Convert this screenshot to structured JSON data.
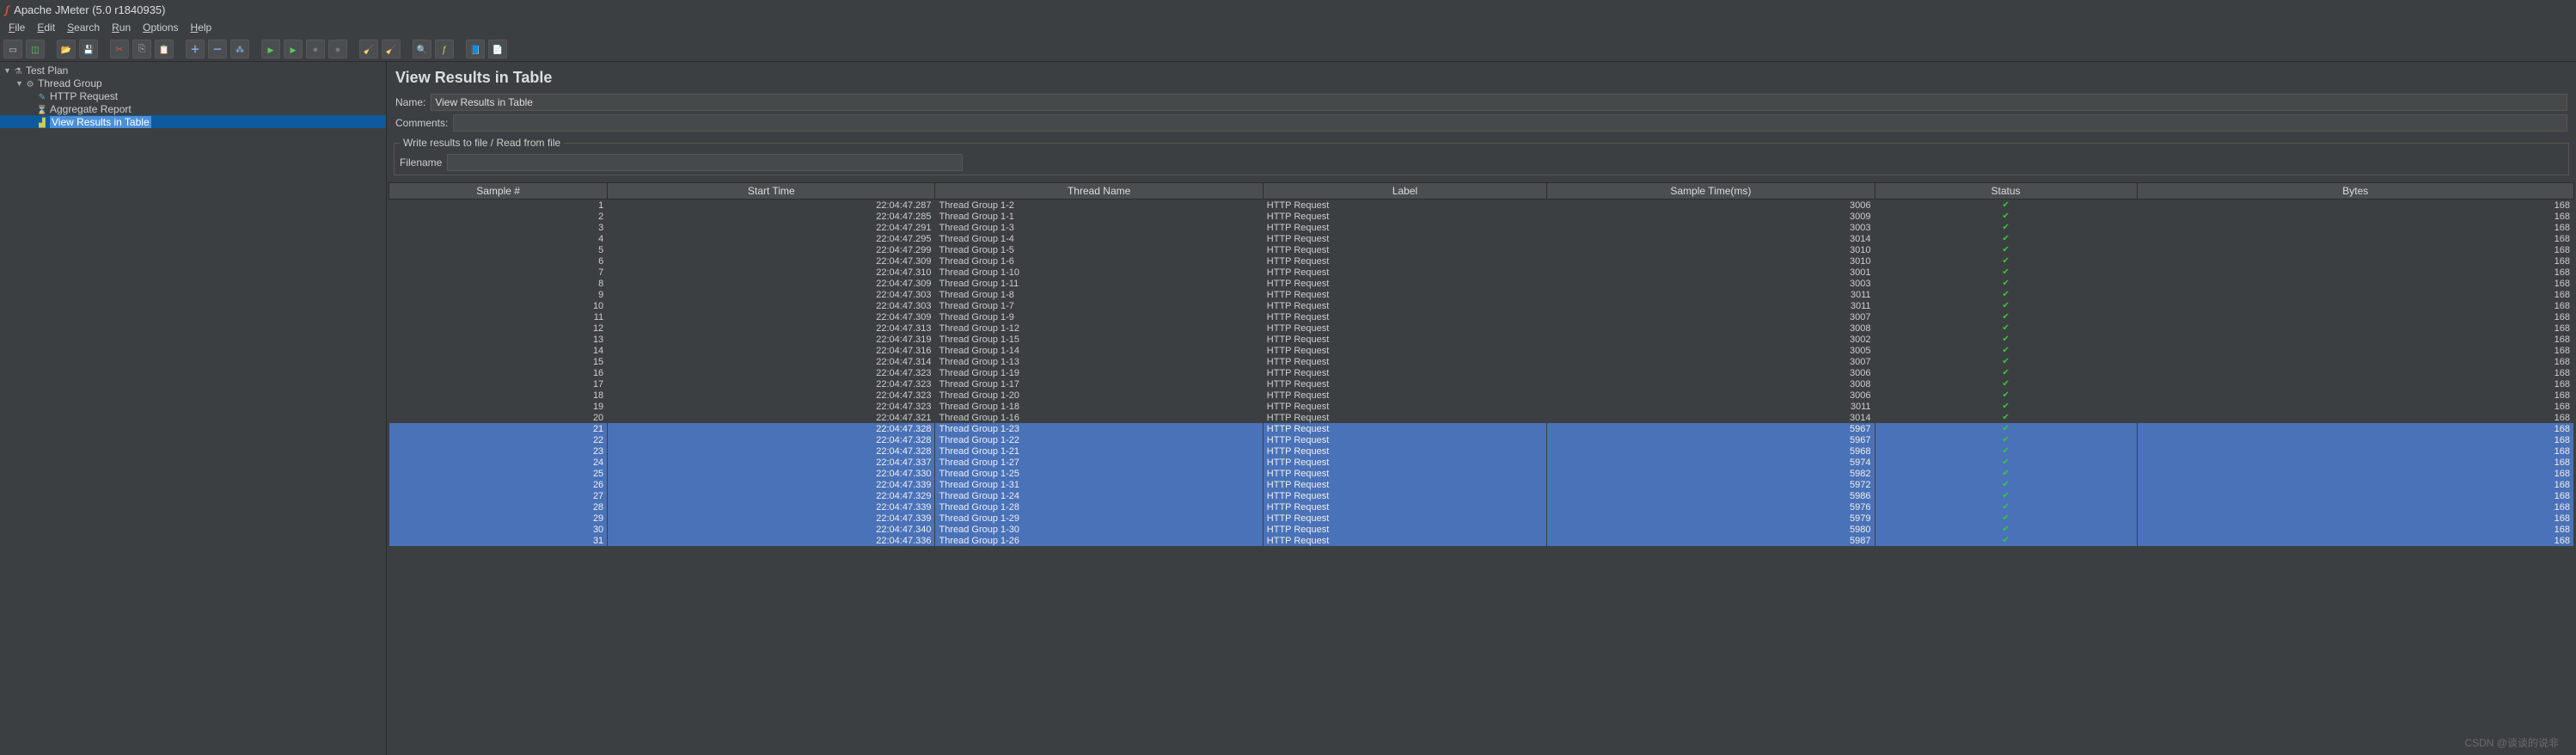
{
  "title": "Apache JMeter (5.0 r1840935)",
  "menu": [
    "File",
    "Edit",
    "Search",
    "Run",
    "Options",
    "Help"
  ],
  "toolbar_icons": [
    "new-icon",
    "templates-icon",
    "sep",
    "open-icon",
    "save-icon",
    "sep",
    "cut-icon",
    "copy-icon",
    "paste-icon",
    "sep",
    "plus-icon",
    "minus-icon",
    "toggle-icon",
    "sep",
    "start-icon",
    "start-no-timers-icon",
    "stop-icon",
    "shutdown-icon",
    "sep",
    "clear-icon",
    "clear-all-icon",
    "sep",
    "search-icon",
    "function-helper-icon",
    "sep",
    "help-icon",
    "help2-icon"
  ],
  "tree": [
    {
      "level": 0,
      "twisty": "▼",
      "icon": "g-flask",
      "label": "Test Plan",
      "name": "tree-test-plan"
    },
    {
      "level": 1,
      "twisty": "▼",
      "icon": "g-gear",
      "label": "Thread Group",
      "name": "tree-thread-group"
    },
    {
      "level": 2,
      "twisty": "",
      "icon": "g-pipette",
      "label": "HTTP Request",
      "name": "tree-http-request"
    },
    {
      "level": 2,
      "twisty": "",
      "icon": "g-report",
      "label": "Aggregate Report",
      "name": "tree-aggregate-report"
    },
    {
      "level": 2,
      "twisty": "",
      "icon": "g-graph",
      "label": "View Results in Table",
      "name": "tree-view-results-table",
      "selected": true
    }
  ],
  "panel": {
    "title": "View Results in Table",
    "name_label": "Name:",
    "name_value": "View Results in Table",
    "comments_label": "Comments:",
    "fieldset_legend": "Write results to file / Read from file",
    "filename_label": "Filename"
  },
  "columns": [
    "Sample #",
    "Start Time",
    "Thread Name",
    "Label",
    "Sample Time(ms)",
    "Status",
    "Bytes"
  ],
  "rows": [
    {
      "n": 1,
      "t": "22:04:47.287",
      "g": "Thread Group 1-2",
      "l": "HTTP Request",
      "ms": 3006,
      "b": 168
    },
    {
      "n": 2,
      "t": "22:04:47.285",
      "g": "Thread Group 1-1",
      "l": "HTTP Request",
      "ms": 3009,
      "b": 168
    },
    {
      "n": 3,
      "t": "22:04:47.291",
      "g": "Thread Group 1-3",
      "l": "HTTP Request",
      "ms": 3003,
      "b": 168
    },
    {
      "n": 4,
      "t": "22:04:47.295",
      "g": "Thread Group 1-4",
      "l": "HTTP Request",
      "ms": 3014,
      "b": 168
    },
    {
      "n": 5,
      "t": "22:04:47.299",
      "g": "Thread Group 1-5",
      "l": "HTTP Request",
      "ms": 3010,
      "b": 168
    },
    {
      "n": 6,
      "t": "22:04:47.309",
      "g": "Thread Group 1-6",
      "l": "HTTP Request",
      "ms": 3010,
      "b": 168
    },
    {
      "n": 7,
      "t": "22:04:47.310",
      "g": "Thread Group 1-10",
      "l": "HTTP Request",
      "ms": 3001,
      "b": 168
    },
    {
      "n": 8,
      "t": "22:04:47.309",
      "g": "Thread Group 1-11",
      "l": "HTTP Request",
      "ms": 3003,
      "b": 168
    },
    {
      "n": 9,
      "t": "22:04:47.303",
      "g": "Thread Group 1-8",
      "l": "HTTP Request",
      "ms": 3011,
      "b": 168
    },
    {
      "n": 10,
      "t": "22:04:47.303",
      "g": "Thread Group 1-7",
      "l": "HTTP Request",
      "ms": 3011,
      "b": 168
    },
    {
      "n": 11,
      "t": "22:04:47.309",
      "g": "Thread Group 1-9",
      "l": "HTTP Request",
      "ms": 3007,
      "b": 168
    },
    {
      "n": 12,
      "t": "22:04:47.313",
      "g": "Thread Group 1-12",
      "l": "HTTP Request",
      "ms": 3008,
      "b": 168
    },
    {
      "n": 13,
      "t": "22:04:47.319",
      "g": "Thread Group 1-15",
      "l": "HTTP Request",
      "ms": 3002,
      "b": 168
    },
    {
      "n": 14,
      "t": "22:04:47.316",
      "g": "Thread Group 1-14",
      "l": "HTTP Request",
      "ms": 3005,
      "b": 168
    },
    {
      "n": 15,
      "t": "22:04:47.314",
      "g": "Thread Group 1-13",
      "l": "HTTP Request",
      "ms": 3007,
      "b": 168
    },
    {
      "n": 16,
      "t": "22:04:47.323",
      "g": "Thread Group 1-19",
      "l": "HTTP Request",
      "ms": 3006,
      "b": 168
    },
    {
      "n": 17,
      "t": "22:04:47.323",
      "g": "Thread Group 1-17",
      "l": "HTTP Request",
      "ms": 3008,
      "b": 168
    },
    {
      "n": 18,
      "t": "22:04:47.323",
      "g": "Thread Group 1-20",
      "l": "HTTP Request",
      "ms": 3006,
      "b": 168
    },
    {
      "n": 19,
      "t": "22:04:47.323",
      "g": "Thread Group 1-18",
      "l": "HTTP Request",
      "ms": 3011,
      "b": 168
    },
    {
      "n": 20,
      "t": "22:04:47.321",
      "g": "Thread Group 1-16",
      "l": "HTTP Request",
      "ms": 3014,
      "b": 168
    },
    {
      "n": 21,
      "t": "22:04:47.328",
      "g": "Thread Group 1-23",
      "l": "HTTP Request",
      "ms": 5967,
      "b": 168,
      "sel": true
    },
    {
      "n": 22,
      "t": "22:04:47.328",
      "g": "Thread Group 1-22",
      "l": "HTTP Request",
      "ms": 5967,
      "b": 168,
      "sel": true
    },
    {
      "n": 23,
      "t": "22:04:47.328",
      "g": "Thread Group 1-21",
      "l": "HTTP Request",
      "ms": 5968,
      "b": 168,
      "sel": true
    },
    {
      "n": 24,
      "t": "22:04:47.337",
      "g": "Thread Group 1-27",
      "l": "HTTP Request",
      "ms": 5974,
      "b": 168,
      "sel": true
    },
    {
      "n": 25,
      "t": "22:04:47.330",
      "g": "Thread Group 1-25",
      "l": "HTTP Request",
      "ms": 5982,
      "b": 168,
      "sel": true
    },
    {
      "n": 26,
      "t": "22:04:47.339",
      "g": "Thread Group 1-31",
      "l": "HTTP Request",
      "ms": 5972,
      "b": 168,
      "sel": true
    },
    {
      "n": 27,
      "t": "22:04:47.329",
      "g": "Thread Group 1-24",
      "l": "HTTP Request",
      "ms": 5986,
      "b": 168,
      "sel": true
    },
    {
      "n": 28,
      "t": "22:04:47.339",
      "g": "Thread Group 1-28",
      "l": "HTTP Request",
      "ms": 5976,
      "b": 168,
      "sel": true
    },
    {
      "n": 29,
      "t": "22:04:47.339",
      "g": "Thread Group 1-29",
      "l": "HTTP Request",
      "ms": 5979,
      "b": 168,
      "sel": true
    },
    {
      "n": 30,
      "t": "22:04:47.340",
      "g": "Thread Group 1-30",
      "l": "HTTP Request",
      "ms": 5980,
      "b": 168,
      "sel": true
    },
    {
      "n": 31,
      "t": "22:04:47.336",
      "g": "Thread Group 1-26",
      "l": "HTTP Request",
      "ms": 5987,
      "b": 168,
      "sel": true
    }
  ],
  "watermark": "CSDN @谈谈的说非"
}
